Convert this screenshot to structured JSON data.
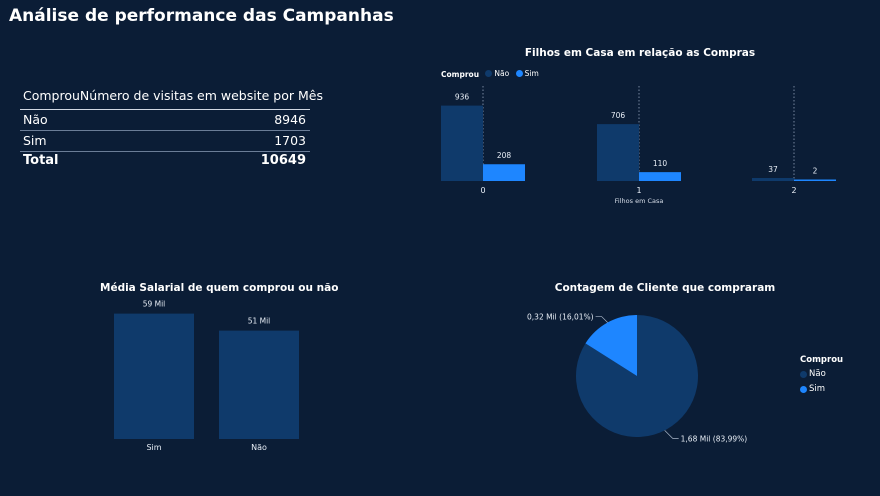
{
  "page_title": "Análise de performance das Campanhas",
  "colors": {
    "background": "#0b1d36",
    "nao": "#0f3a6b",
    "sim": "#1e86ff",
    "text": "#ffffff",
    "muted": "#c9d2de",
    "line": "#6b7d97"
  },
  "table": {
    "headers": [
      "Comprou",
      "Número de visitas em website por Mês"
    ],
    "rows": [
      {
        "label": "Não",
        "value": "8946"
      },
      {
        "label": "Sim",
        "value": "1703"
      }
    ],
    "total": {
      "label": "Total",
      "value": "10649"
    }
  },
  "chart_data": [
    {
      "id": "filhos",
      "type": "bar",
      "title": "Filhos em Casa em relação as Compras",
      "xlabel": "Filhos em Casa",
      "ylabel": "",
      "legend_title": "Comprou",
      "legend_position": "top-left",
      "categories": [
        "0",
        "1",
        "2"
      ],
      "series": [
        {
          "name": "Não",
          "values": [
            936,
            706,
            37
          ],
          "color": "#0f3a6b"
        },
        {
          "name": "Sim",
          "values": [
            208,
            110,
            2
          ],
          "color": "#1e86ff"
        }
      ],
      "ylim": [
        0,
        1000
      ],
      "grid": false
    },
    {
      "id": "salario",
      "type": "bar",
      "title": "Média Salarial de quem comprou ou não",
      "xlabel": "",
      "ylabel": "",
      "categories": [
        "Sim",
        "Não"
      ],
      "values": [
        59,
        51
      ],
      "data_labels": [
        "59 Mil",
        "51 Mil"
      ],
      "ylim": [
        0,
        60
      ],
      "grid": false
    },
    {
      "id": "clientes",
      "type": "pie",
      "title": "Contagem de Cliente que compraram",
      "legend_title": "Comprou",
      "legend_position": "right",
      "slices": [
        {
          "name": "Não",
          "value": 83.99,
          "label": "1,68 Mil (83,99%)",
          "color": "#0f3a6b"
        },
        {
          "name": "Sim",
          "value": 16.01,
          "label": "0,32 Mil (16,01%)",
          "color": "#1e86ff"
        }
      ]
    }
  ]
}
